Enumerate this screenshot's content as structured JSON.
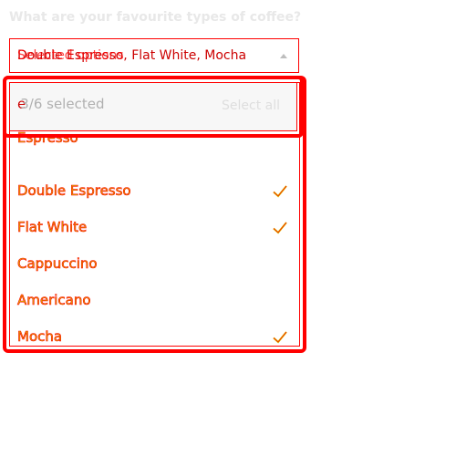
{
  "question": "What are your favourite types of coffee?",
  "select": {
    "value": "Double Espresso, Flat White, Mocha",
    "ghost_value": "Selected options"
  },
  "search": {
    "typed": "e",
    "selected_count_text": "3/6 selected",
    "select_all_label": "Select all"
  },
  "options": [
    {
      "label": "Espresso",
      "checked": false
    },
    {
      "label": "Double Espresso",
      "checked": true
    },
    {
      "label": "Flat White",
      "checked": true
    },
    {
      "label": "Cappuccino",
      "checked": false
    },
    {
      "label": "Americano",
      "checked": false
    },
    {
      "label": "Mocha",
      "checked": true
    }
  ],
  "colors": {
    "highlight": "#ff0000",
    "option_text": "#d9b800",
    "muted": "#e0e0e0"
  },
  "icons": {
    "check": "check-icon",
    "caret": "caret-up-icon"
  }
}
